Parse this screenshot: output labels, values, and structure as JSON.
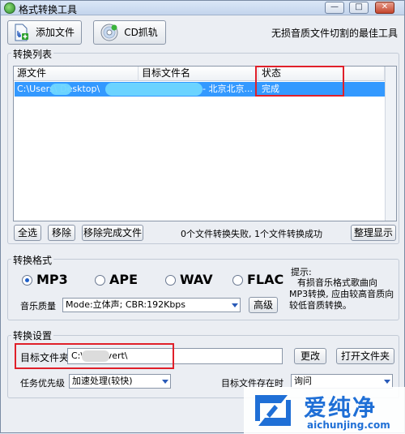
{
  "window": {
    "title": "格式转换工具",
    "controls": {
      "minimize": "—",
      "maximize": "□",
      "close": "✕"
    }
  },
  "toolbar": {
    "add_file_label": "添加文件",
    "cd_rip_label": "CD抓轨",
    "slogan": "无损音质文件切割的最佳工具"
  },
  "convert_list": {
    "title": "转换列表",
    "columns": [
      "源文件",
      "目标文件名",
      "状态"
    ],
    "rows": [
      {
        "source": "C:\\Users\\  Desktop\\",
        "target": "- 北京北京...",
        "status": "完成"
      }
    ],
    "buttons": {
      "select_all": "全选",
      "remove": "移除",
      "remove_done": "移除完成文件",
      "tidy": "整理显示"
    },
    "summary": "0个文件转换失败, 1个文件转换成功"
  },
  "format": {
    "title": "转换格式",
    "options": [
      "MP3",
      "APE",
      "WAV",
      "FLAC"
    ],
    "selected": "MP3",
    "hint_title": "提示:",
    "hint_body": "有损音乐格式歌曲向MP3转换, 应由较高音质向较低音质转换。",
    "quality_label": "音乐质量",
    "quality_value": "Mode:立体声; CBR:192Kbps",
    "advanced_label": "高级"
  },
  "settings": {
    "title": "转换设置",
    "target_folder_label": "目标文件夹",
    "target_folder_value": "C:\\            \\Convert\\",
    "change_label": "更改",
    "open_folder_label": "打开文件夹",
    "priority_label": "任务优先级",
    "priority_value": "加速处理(较快)",
    "exists_label": "目标文件存在时",
    "exists_value": "询问"
  },
  "watermark": {
    "brand": "爱纯净",
    "url": "aichunjing.com"
  },
  "colors": {
    "selection": "#3399ff",
    "highlight_box": "#e0202a",
    "accent": "#1e5fc8"
  }
}
